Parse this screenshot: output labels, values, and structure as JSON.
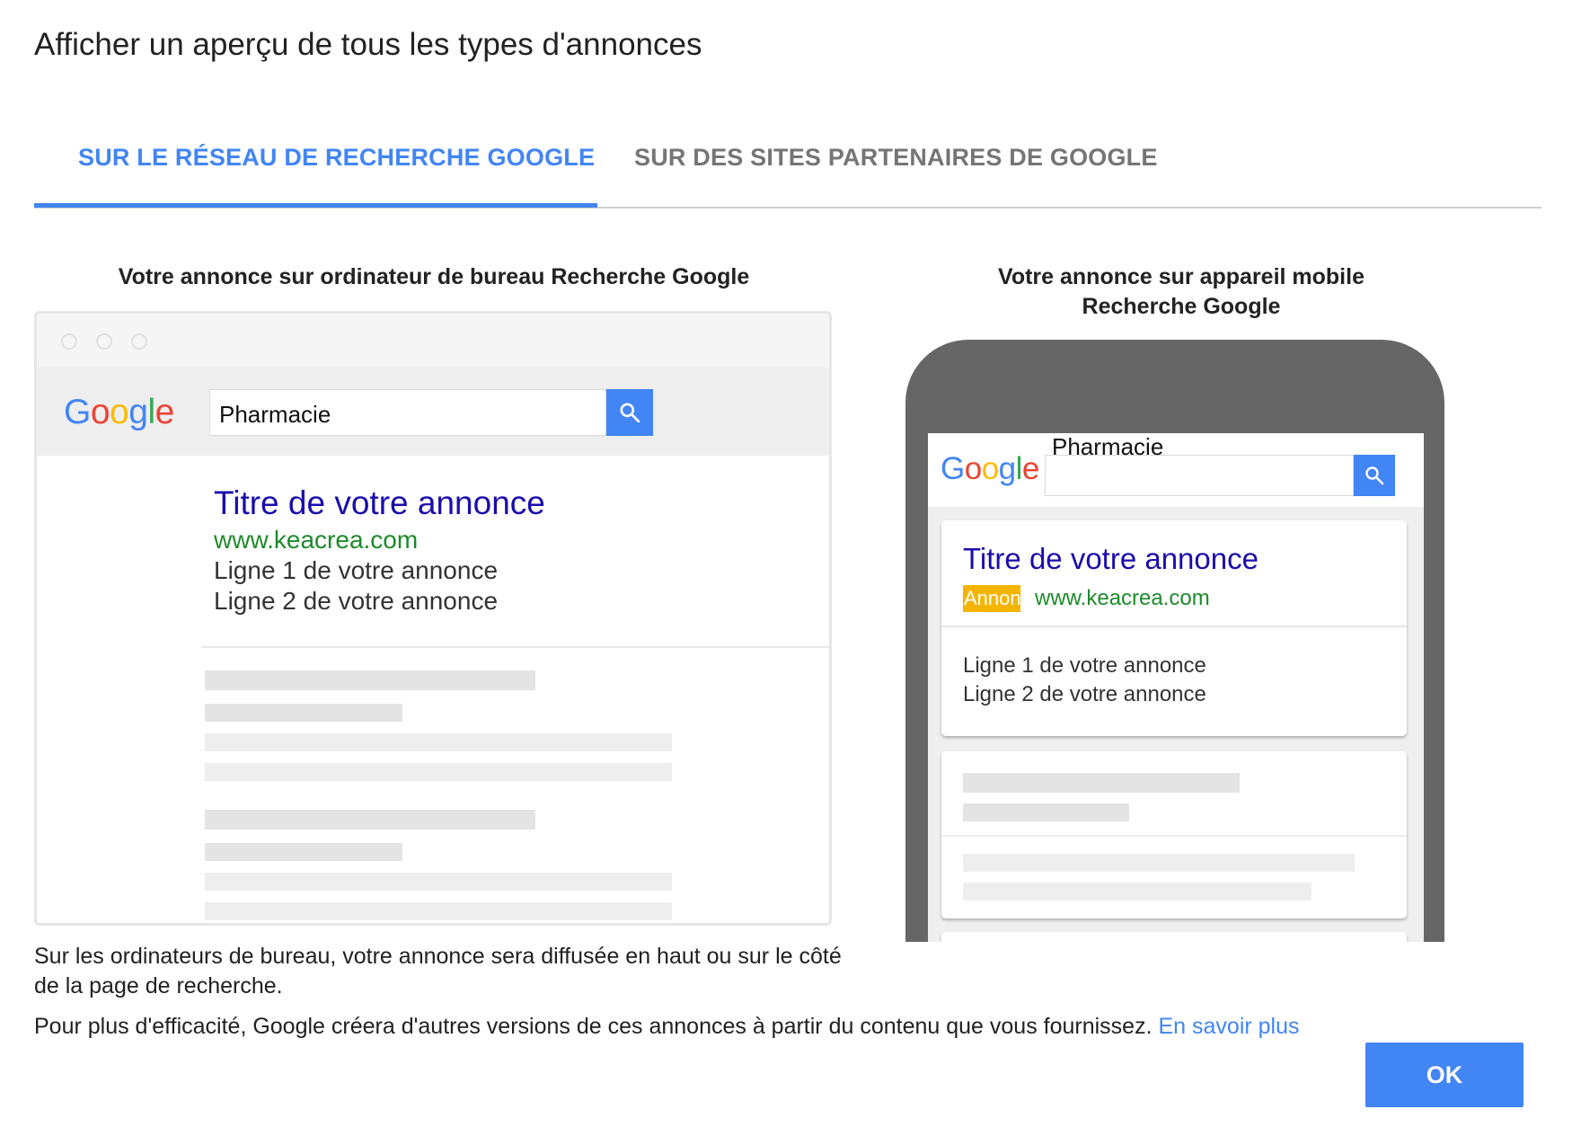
{
  "dialog": {
    "title": "Afficher un aperçu de tous les types d'annonces"
  },
  "tabs": [
    {
      "label": "SUR LE RÉSEAU DE RECHERCHE GOOGLE",
      "active": true
    },
    {
      "label": "SUR DES SITES PARTENAIRES DE GOOGLE",
      "active": false
    }
  ],
  "desktop_preview": {
    "heading": "Votre annonce sur ordinateur de bureau Recherche Google",
    "logo_letters": [
      "G",
      "o",
      "o",
      "g",
      "l",
      "e"
    ],
    "search_query": "Pharmacie",
    "search_icon": "search-icon",
    "ad": {
      "title": "Titre de votre annonce",
      "url": "www.keacrea.com",
      "line1": "Ligne 1 de votre annonce",
      "line2": "Ligne 2 de votre annonce"
    }
  },
  "mobile_preview": {
    "heading_line1": "Votre annonce sur appareil mobile",
    "heading_line2": "Recherche Google",
    "logo_letters": [
      "G",
      "o",
      "o",
      "g",
      "l",
      "e"
    ],
    "search_query": "Pharmacie",
    "search_icon": "search-icon",
    "ad": {
      "title": "Titre de votre annonce",
      "badge": "Annon",
      "url": "www.keacrea.com",
      "line1": "Ligne 1 de votre annonce",
      "line2": "Ligne 2 de votre annonce"
    }
  },
  "description": {
    "desktop_note": "Sur les ordinateurs de bureau, votre annonce sera diffusée en haut ou sur le côté de la page de recherche.",
    "efficiency_note": "Pour plus d'efficacité, Google créera d'autres versions de ces annonces à partir du contenu que vous fournissez.",
    "learn_more": "En savoir plus"
  },
  "actions": {
    "ok_label": "OK"
  },
  "colors": {
    "accent": "#4285f4",
    "ad_title": "#1a0dab",
    "ad_url": "#1e8a2a",
    "ad_badge": "#f4b400",
    "inactive_tab": "#757575",
    "logo": [
      "#4285f4",
      "#ea4335",
      "#fbbc05",
      "#4285f4",
      "#34a853",
      "#ea4335"
    ]
  }
}
